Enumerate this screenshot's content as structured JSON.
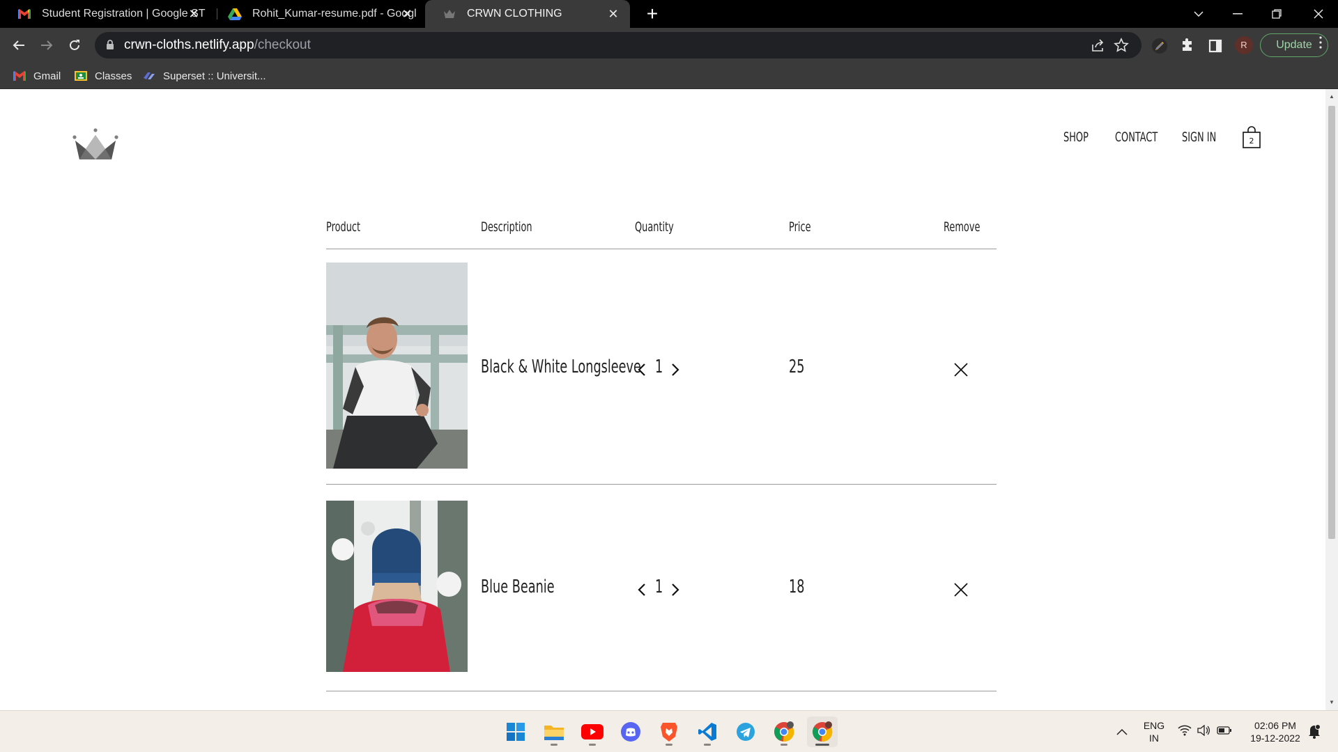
{
  "browser": {
    "tabs": [
      {
        "title": "Student Registration | Google ST",
        "icon": "gmail-icon",
        "active": false
      },
      {
        "title": "Rohit_Kumar-resume.pdf - Googl",
        "icon": "google-drive-icon",
        "active": false
      },
      {
        "title": "CRWN CLOTHING",
        "icon": "crown-icon",
        "active": true
      }
    ],
    "tab_close_glyph": "✕",
    "new_tab_glyph": "+",
    "address": {
      "host": "crwn-cloths.netlify.app",
      "path": "/checkout"
    },
    "profile_initial": "R",
    "update_label": "Update",
    "bookmarks": [
      {
        "label": "Gmail",
        "icon": "gmail-icon"
      },
      {
        "label": "Classes",
        "icon": "classroom-icon"
      },
      {
        "label": "Superset :: Universit...",
        "icon": "superset-icon"
      }
    ]
  },
  "site": {
    "nav": {
      "shop": "SHOP",
      "contact": "CONTACT",
      "sign_in": "SIGN IN"
    },
    "cart_count": "2"
  },
  "checkout": {
    "headers": {
      "product": "Product",
      "description": "Description",
      "quantity": "Quantity",
      "price": "Price",
      "remove": "Remove"
    },
    "items": [
      {
        "name": "Black & White Longsleeve",
        "quantity": "1",
        "price": "25",
        "image": "man-in-longsleeve-photo"
      },
      {
        "name": "Blue Beanie",
        "quantity": "1",
        "price": "18",
        "image": "woman-in-blue-beanie-photo"
      }
    ]
  },
  "taskbar": {
    "apps": [
      "windows-start-icon",
      "file-explorer-icon",
      "youtube-icon",
      "discord-icon",
      "brave-icon",
      "vscode-icon",
      "telegram-icon",
      "chrome-icon",
      "chrome-profile-icon"
    ],
    "language": {
      "line1": "ENG",
      "line2": "IN"
    },
    "clock": {
      "time": "02:06 PM",
      "date": "19-12-2022"
    }
  },
  "colors": {
    "tabbar": "#000000",
    "toolbar": "#3a3a3a",
    "omnibox": "#202124",
    "update_green": "#5ea96a",
    "taskbar": "#f3eee7"
  }
}
